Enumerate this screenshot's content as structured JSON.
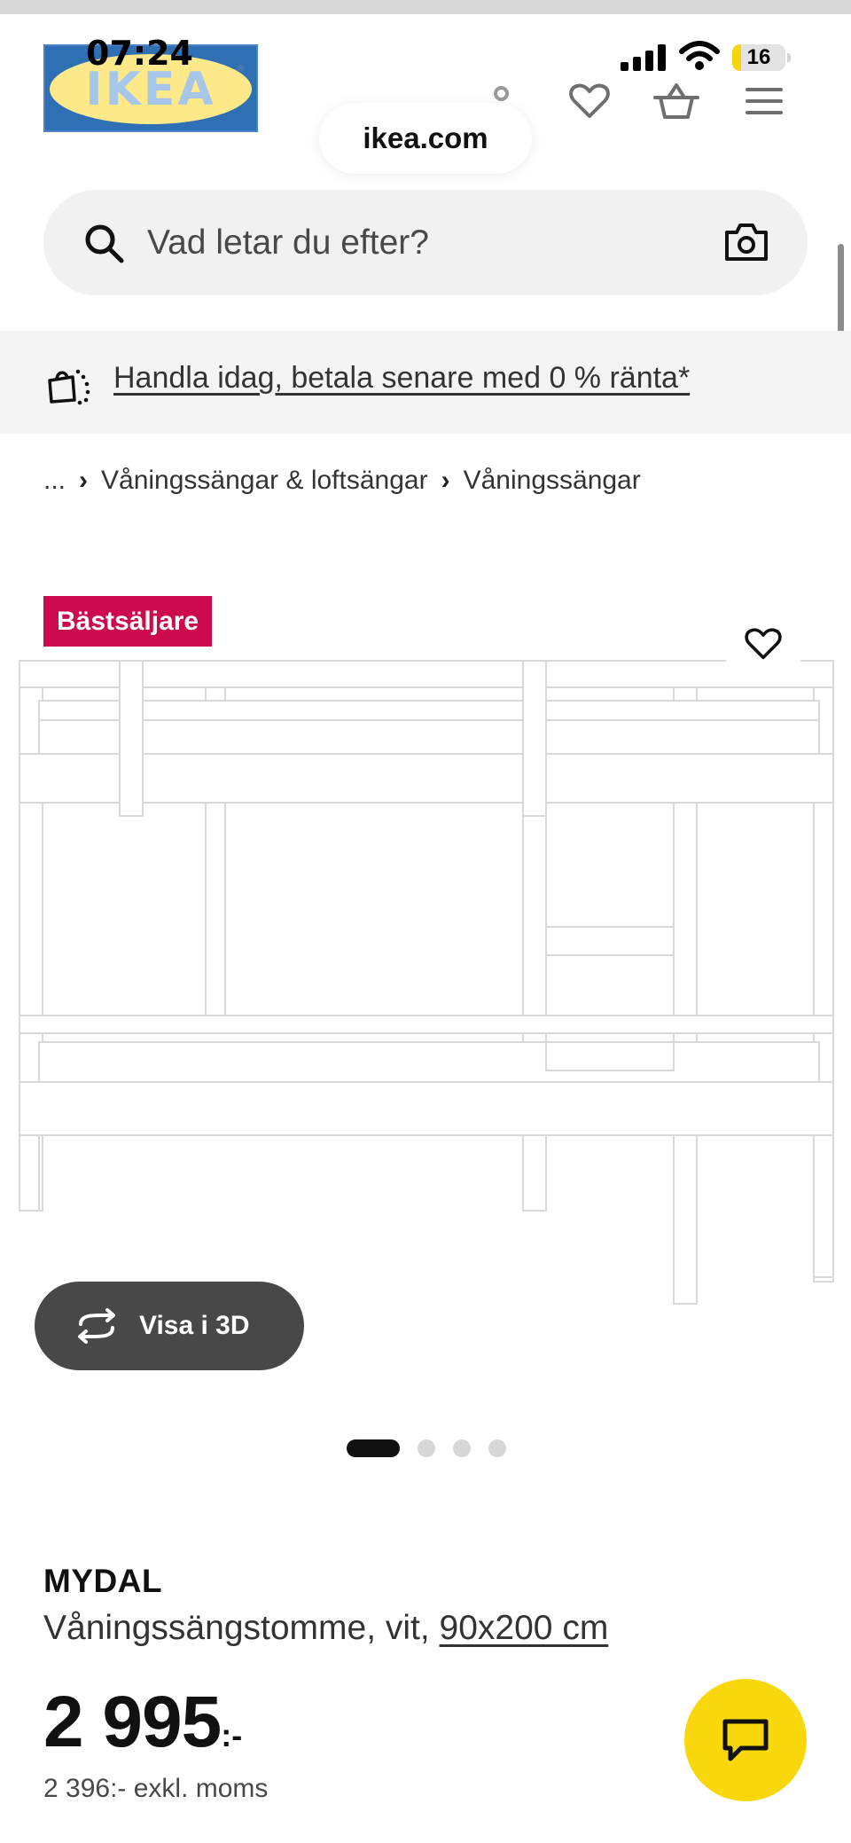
{
  "status_bar": {
    "time": "07:24",
    "battery_level": "16",
    "battery_fraction": 0.16
  },
  "header": {
    "logo_text": "IKEA",
    "logo_registered": "®",
    "url": "ikea.com",
    "icons": [
      "person-icon",
      "heart-icon",
      "cart-icon",
      "menu-icon"
    ]
  },
  "search": {
    "placeholder": "Vad letar du efter?",
    "icons": [
      "search-icon",
      "camera-icon"
    ]
  },
  "promo": {
    "text": "Handla idag, betala senare med 0 % ränta*"
  },
  "breadcrumb": {
    "items": [
      "...",
      "Våningssängar & loftsängar",
      "Våningssängar"
    ]
  },
  "product": {
    "badge": "Bästsäljare",
    "view_3d_label": "Visa i 3D",
    "carousel": {
      "total": 4,
      "active": 1
    },
    "name": "MYDAL",
    "description": "Våningssängstomme, vit, ",
    "size": "90x200 cm",
    "price": "2 995",
    "price_suffix": ":-",
    "price_excl_vat": "2 396:- exkl. moms"
  },
  "colors": {
    "badge": "#cc0a4d",
    "chat_button": "#f8d80c",
    "view_3d_button": "#484848",
    "battery_fill": "#f5d50b"
  }
}
